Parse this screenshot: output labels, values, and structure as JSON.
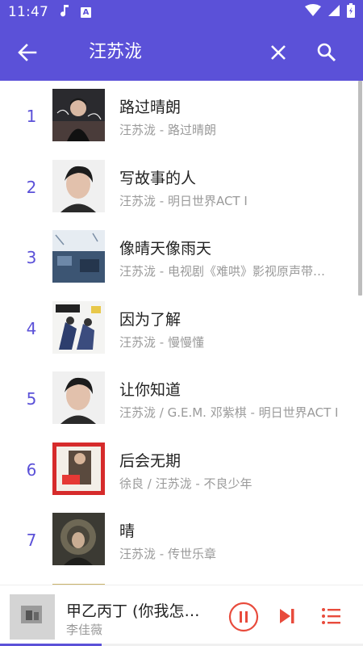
{
  "status_bar": {
    "time": "11:47",
    "left_icons": [
      "music-note-icon",
      "a-letter-icon"
    ],
    "a_letter": "A",
    "right_icons": [
      "wifi-icon",
      "cellular-signal-icon",
      "battery-icon"
    ]
  },
  "app_bar": {
    "search_query": "汪苏泷",
    "icons": [
      "arrow-left-icon",
      "close-icon",
      "search-icon"
    ]
  },
  "colors": {
    "primary": "#5b51d8",
    "accent": "#e84b3c",
    "title_text": "#222222",
    "subtitle_text": "#9a9a9a"
  },
  "songs": [
    {
      "rank": "1",
      "title": "路过晴朗",
      "subtitle": "汪苏泷 - 路过晴朗"
    },
    {
      "rank": "2",
      "title": "写故事的人",
      "subtitle": "汪苏泷 - 明日世界ACT I"
    },
    {
      "rank": "3",
      "title": "像晴天像雨天",
      "subtitle": "汪苏泷 - 电视剧《难哄》影视原声带…"
    },
    {
      "rank": "4",
      "title": "因为了解",
      "subtitle": "汪苏泷 - 慢慢懂"
    },
    {
      "rank": "5",
      "title": "让你知道",
      "subtitle": "汪苏泷 / G.E.M. 邓紫棋 - 明日世界ACT I"
    },
    {
      "rank": "6",
      "title": "后会无期",
      "subtitle": "徐良 / 汪苏泷 - 不良少年"
    },
    {
      "rank": "7",
      "title": "晴",
      "subtitle": "汪苏泷 - 传世乐章"
    }
  ],
  "player": {
    "title": "甲乙丙丁 (你我怎…",
    "artist": "李佳薇",
    "progress": 0.28,
    "icons": [
      "pause-icon",
      "skip-next-icon",
      "queue-list-icon"
    ]
  }
}
